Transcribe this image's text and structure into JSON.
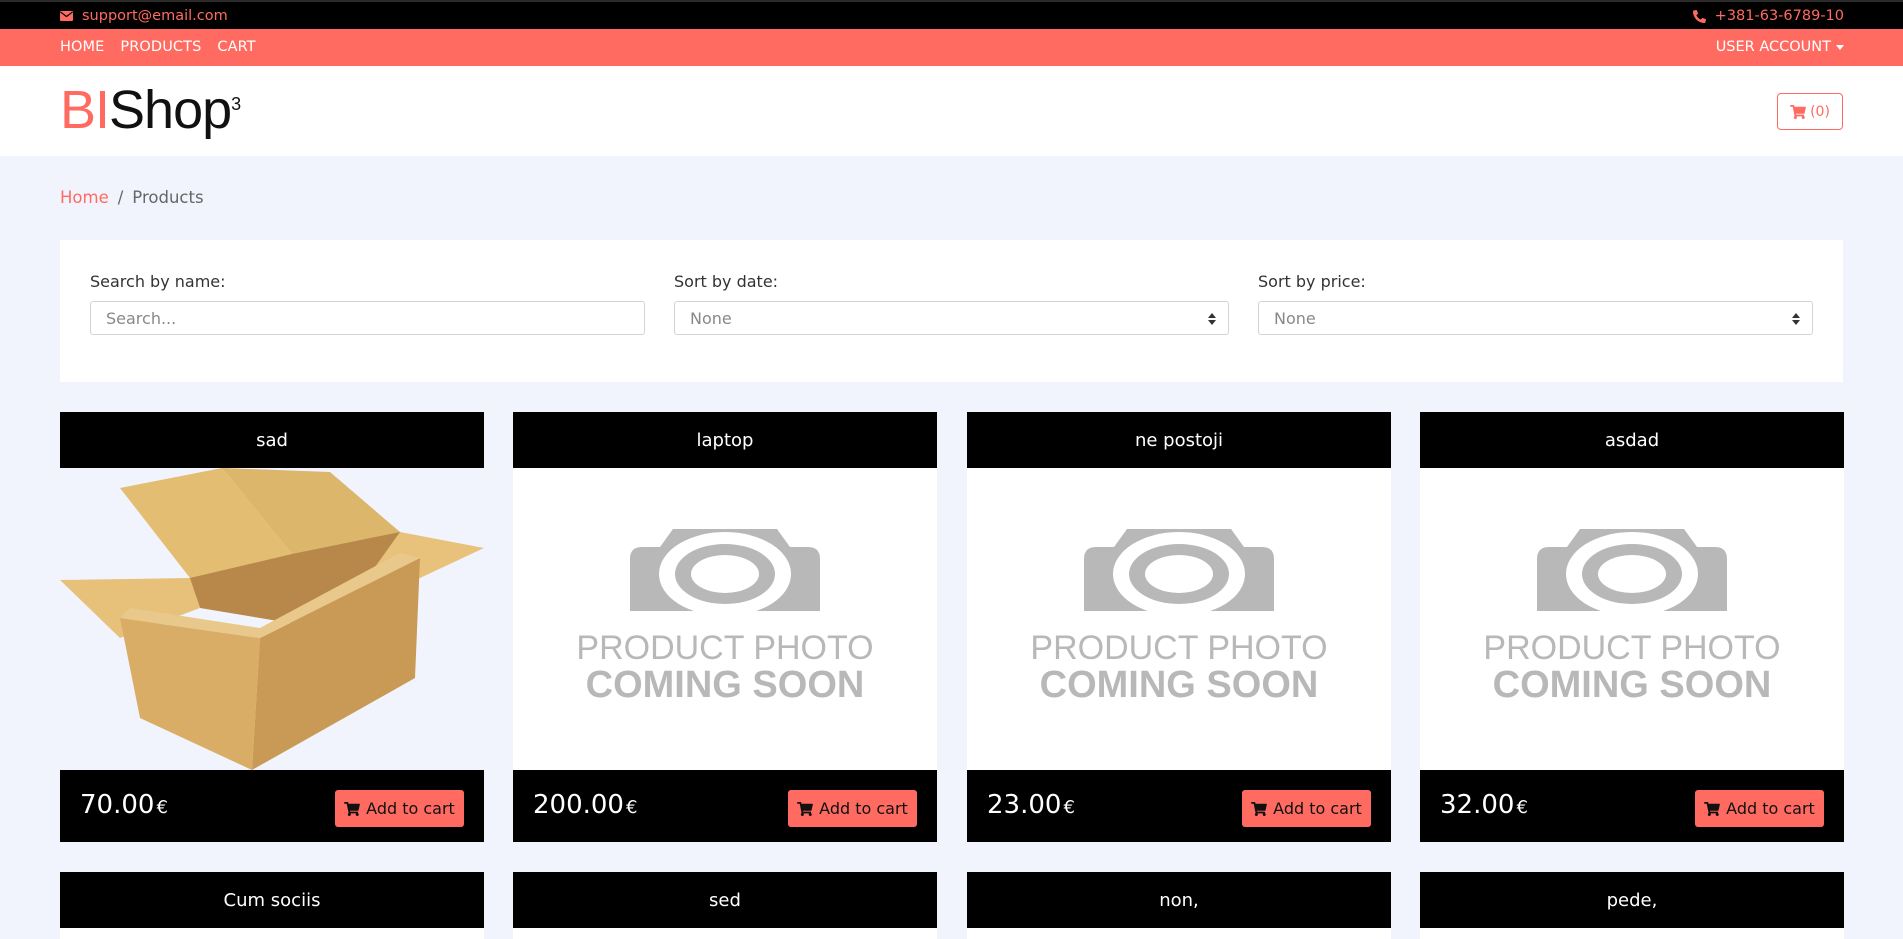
{
  "topbar": {
    "email": "support@email.com",
    "phone": "+381-63-6789-10"
  },
  "nav": {
    "links": [
      "HOME",
      "PRODUCTS",
      "CART"
    ],
    "account": "USER ACCOUNT"
  },
  "header": {
    "logo_bi": "BI",
    "logo_shop": "Shop",
    "logo_sup": "3",
    "cart_count": "(0)"
  },
  "breadcrumb": {
    "home": "Home",
    "separator": "/",
    "current": "Products"
  },
  "filters": {
    "search_label": "Search by name:",
    "search_placeholder": "Search...",
    "date_label": "Sort by date:",
    "date_value": "None",
    "price_label": "Sort by price:",
    "price_value": "None"
  },
  "products": [
    {
      "name": "sad",
      "price": "70.00",
      "currency": "€",
      "image": "cardboard-box",
      "add_label": "Add to cart"
    },
    {
      "name": "laptop",
      "price": "200.00",
      "currency": "€",
      "image": "coming-soon",
      "add_label": "Add to cart"
    },
    {
      "name": "ne postoji",
      "price": "23.00",
      "currency": "€",
      "image": "coming-soon",
      "add_label": "Add to cart"
    },
    {
      "name": "asdad",
      "price": "32.00",
      "currency": "€",
      "image": "coming-soon",
      "add_label": "Add to cart"
    },
    {
      "name": "Cum sociis"
    },
    {
      "name": "sed"
    },
    {
      "name": "non,"
    },
    {
      "name": "pede,"
    }
  ],
  "coming_soon": {
    "line1": "PRODUCT PHOTO",
    "line2": "COMING SOON"
  },
  "colors": {
    "accent": "#ff6b61",
    "black": "#000000",
    "page_bg": "#f1f4fd"
  }
}
